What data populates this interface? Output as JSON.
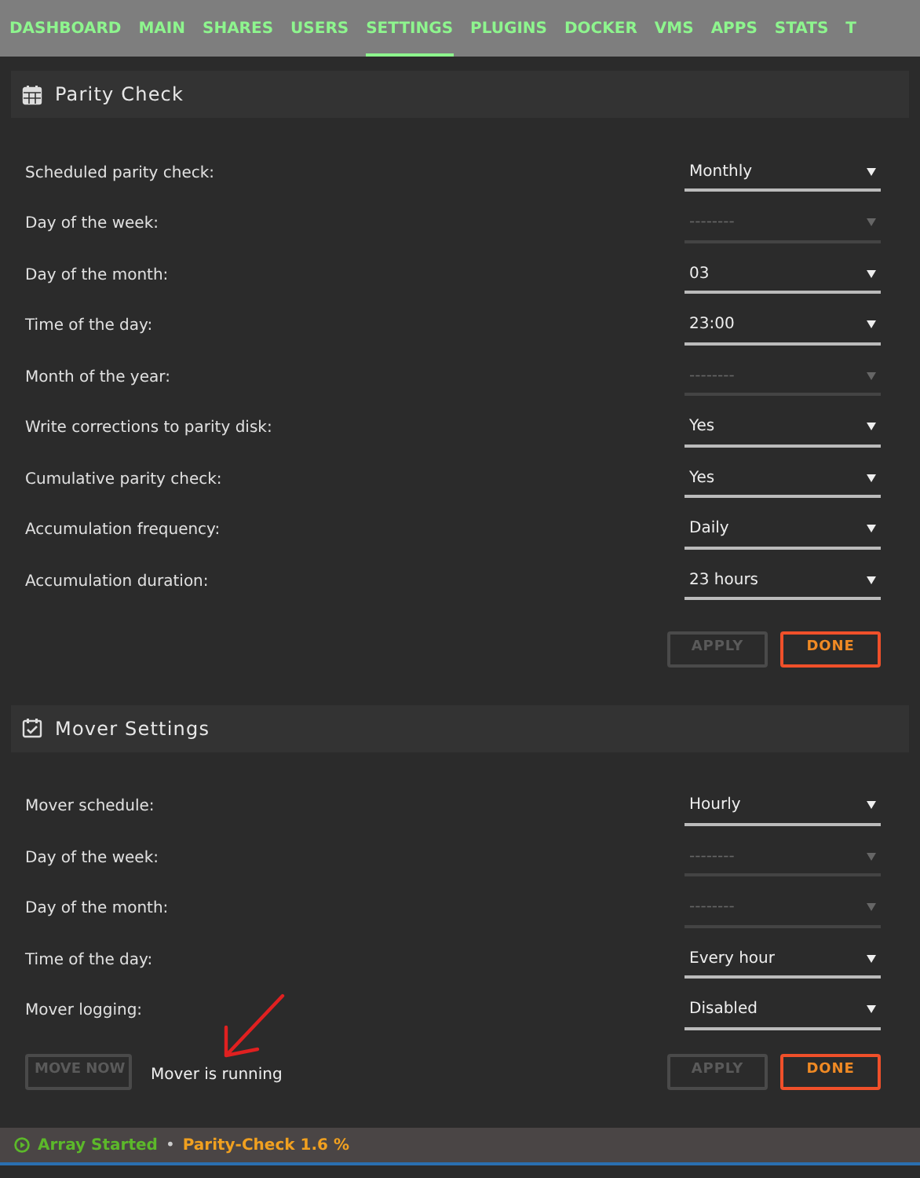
{
  "nav": [
    {
      "label": "DASHBOARD",
      "selected": false
    },
    {
      "label": "MAIN",
      "selected": false
    },
    {
      "label": "SHARES",
      "selected": false
    },
    {
      "label": "USERS",
      "selected": false
    },
    {
      "label": "SETTINGS",
      "selected": true
    },
    {
      "label": "PLUGINS",
      "selected": false
    },
    {
      "label": "DOCKER",
      "selected": false
    },
    {
      "label": "VMS",
      "selected": false
    },
    {
      "label": "APPS",
      "selected": false
    },
    {
      "label": "STATS",
      "selected": false
    },
    {
      "label": "T",
      "selected": false
    }
  ],
  "sections": [
    {
      "title": "Parity Check",
      "fields": [
        {
          "label": "Scheduled parity check:",
          "value": "Monthly",
          "disabled": false
        },
        {
          "label": "Day of the week:",
          "value": "--------",
          "disabled": true
        },
        {
          "label": "Day of the month:",
          "value": "03",
          "disabled": false
        },
        {
          "label": "Time of the day:",
          "value": "23:00",
          "disabled": false
        },
        {
          "label": "Month of the year:",
          "value": "--------",
          "disabled": true
        },
        {
          "label": "Write corrections to parity disk:",
          "value": "Yes",
          "disabled": false
        },
        {
          "label": "Cumulative parity check:",
          "value": "Yes",
          "disabled": false
        },
        {
          "label": "Accumulation frequency:",
          "value": "Daily",
          "disabled": false
        },
        {
          "label": "Accumulation duration:",
          "value": "23 hours",
          "disabled": false
        }
      ],
      "apply": {
        "label": "APPLY",
        "disabled": true
      },
      "done": {
        "label": "DONE",
        "disabled": false
      }
    },
    {
      "title": "Mover Settings",
      "fields": [
        {
          "label": "Mover schedule:",
          "value": "Hourly",
          "disabled": false
        },
        {
          "label": "Day of the week:",
          "value": "--------",
          "disabled": true
        },
        {
          "label": "Day of the month:",
          "value": "--------",
          "disabled": true
        },
        {
          "label": "Time of the day:",
          "value": "Every hour",
          "disabled": false
        },
        {
          "label": "Mover logging:",
          "value": "Disabled",
          "disabled": false
        }
      ],
      "move_now": {
        "label": "MOVE NOW",
        "disabled": true
      },
      "status": "Mover is running",
      "apply": {
        "label": "APPLY",
        "disabled": true
      },
      "done": {
        "label": "DONE",
        "disabled": false
      }
    }
  ],
  "status_bar": {
    "array": "Array Started",
    "separator": "•",
    "parity": "Parity-Check 1.6 %"
  }
}
